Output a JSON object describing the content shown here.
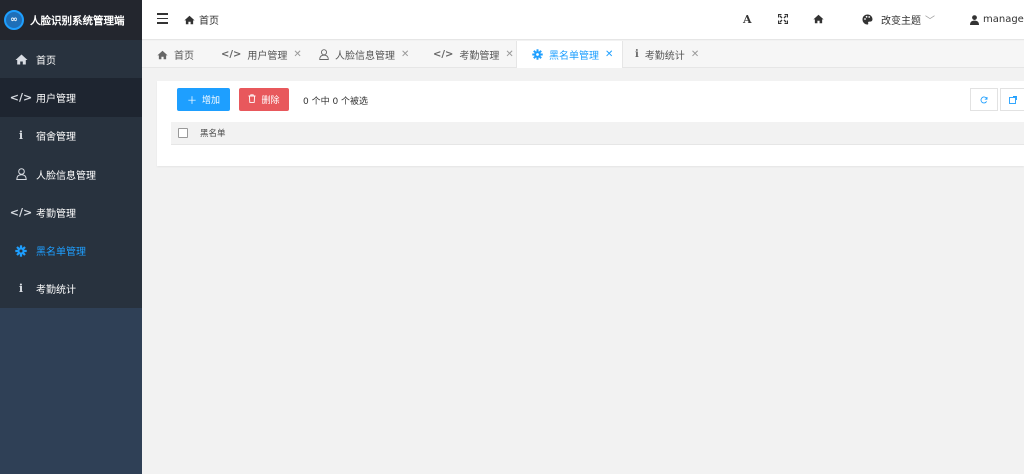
{
  "app": {
    "title": "人脸识别系统管理端",
    "logo_icon": "infinity-icon"
  },
  "sidebar": {
    "items": [
      {
        "label": "首页",
        "icon": "home-icon"
      },
      {
        "label": "用户管理",
        "icon": "code-icon"
      },
      {
        "label": "宿舍管理",
        "icon": "info-icon"
      },
      {
        "label": "人脸信息管理",
        "icon": "user-icon"
      },
      {
        "label": "考勤管理",
        "icon": "code-icon"
      },
      {
        "label": "黑名单管理",
        "icon": "gear-icon",
        "active": true
      },
      {
        "label": "考勤统计",
        "icon": "info-icon"
      }
    ]
  },
  "header": {
    "breadcrumb": "首页",
    "theme_label": "改变主题",
    "user_label": "manage"
  },
  "tabs": [
    {
      "label": "首页",
      "icon": "home-icon"
    },
    {
      "label": "用户管理",
      "icon": "code-icon",
      "closable": true
    },
    {
      "label": "人脸信息管理",
      "icon": "user-icon",
      "closable": true
    },
    {
      "label": "考勤管理",
      "icon": "code-icon",
      "closable": true
    },
    {
      "label": "黑名单管理",
      "icon": "gear-icon",
      "closable": true,
      "active": true
    },
    {
      "label": "考勤统计",
      "icon": "info-icon",
      "closable": true
    }
  ],
  "toolbar": {
    "add_label": "增加",
    "delete_label": "删除",
    "selection_text": "0 个中 0 个被选"
  },
  "table": {
    "columns": [
      "黑名单"
    ]
  },
  "colors": {
    "sidebar_bg": "#2f4056",
    "accent": "#1e9fff",
    "danger": "#e8585c"
  }
}
